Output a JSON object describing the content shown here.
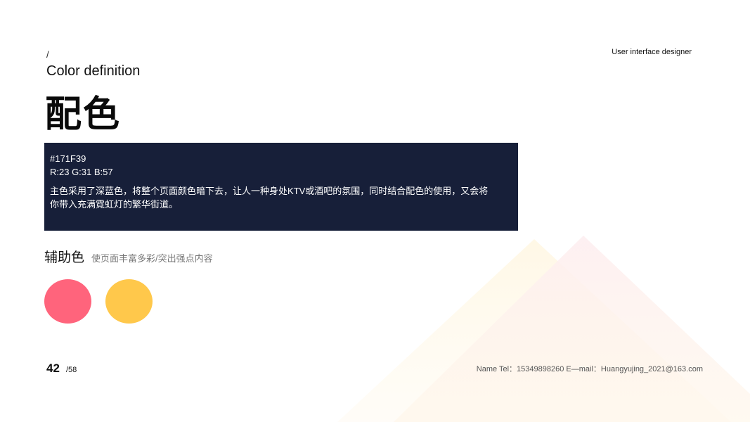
{
  "header": {
    "slash": "/",
    "subtitle": "Color definition",
    "title": "配色",
    "role": "User interface designer"
  },
  "main_color": {
    "hex_label": "#171F39",
    "rgb_label": "R:23 G:31 B:57",
    "description": "主色采用了深蓝色，将整个页面颜色暗下去，让人一种身处KTV或酒吧的氛围，同时结合配色的使用，又会将你带入充满霓虹灯的繁华街道。",
    "color": "#171F39"
  },
  "auxiliary": {
    "title": "辅助色",
    "subtitle": "使页面丰富多彩/突出强点内容",
    "swatches": [
      {
        "color": "#FF647C"
      },
      {
        "color": "#FFC84B"
      }
    ]
  },
  "footer": {
    "page": "42",
    "total": "/58",
    "contact": "Name  Tel：15349898260  E—mail：Huangyujing_2021@163.com"
  }
}
